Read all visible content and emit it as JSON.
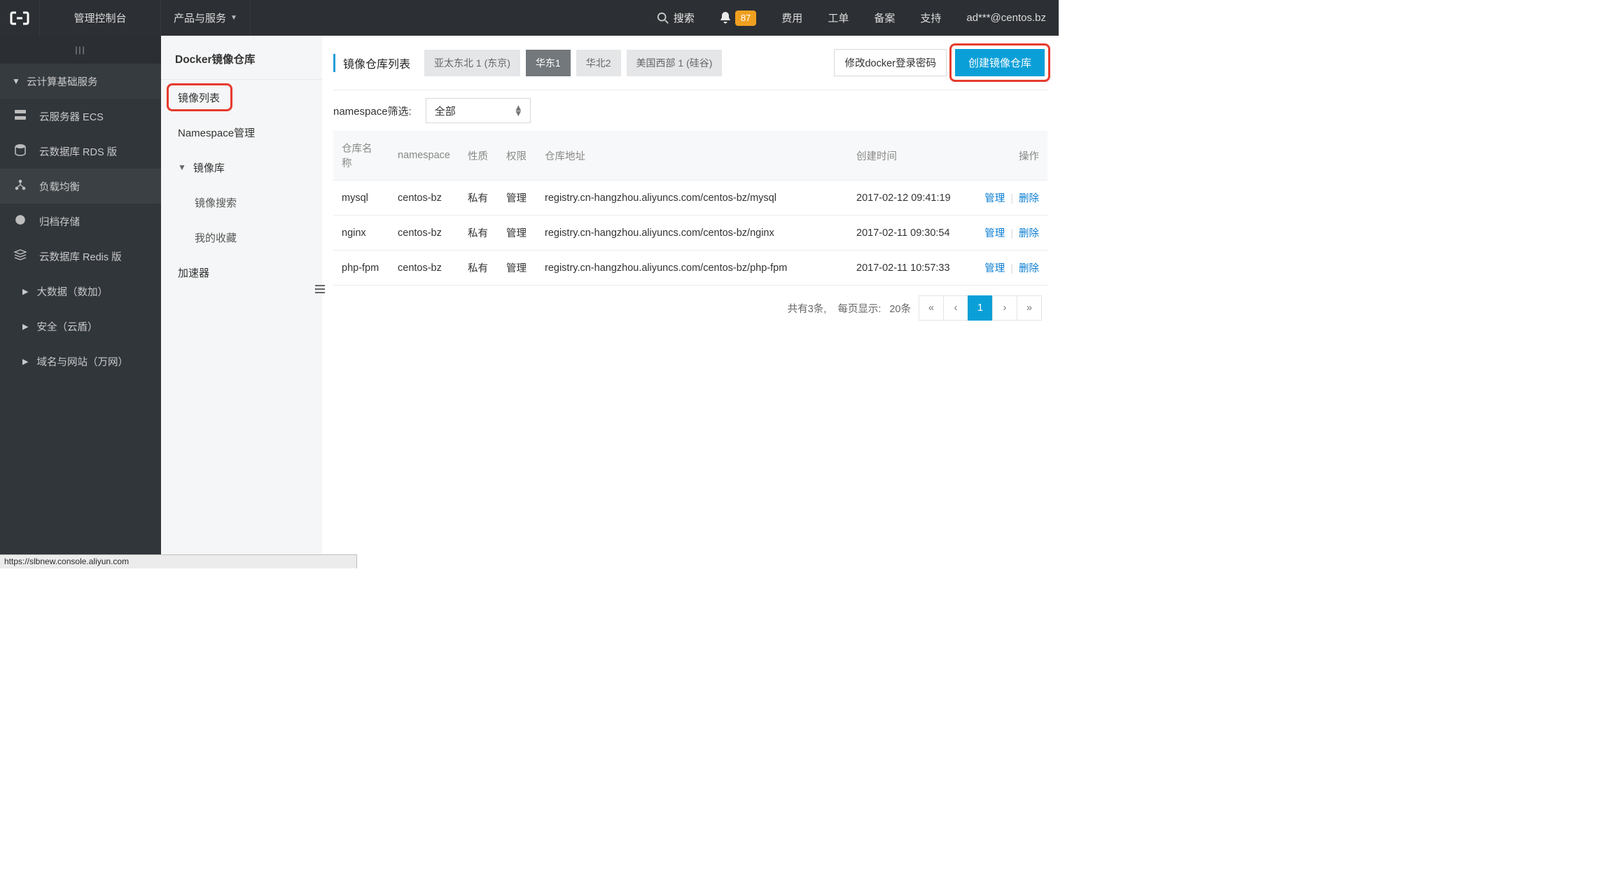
{
  "top": {
    "console": "管理控制台",
    "products": "产品与服务",
    "search": "搜索",
    "badge": "87",
    "links": [
      "费用",
      "工单",
      "备案",
      "支持"
    ],
    "account": "ad***@centos.bz"
  },
  "side_dark": {
    "group_head": "云计算基础服务",
    "items": [
      {
        "name": "ecs",
        "label": "云服务器 ECS"
      },
      {
        "name": "rds",
        "label": "云数据库 RDS 版"
      },
      {
        "name": "slb",
        "label": "负载均衡",
        "active": true
      },
      {
        "name": "oss",
        "label": "归档存储"
      },
      {
        "name": "redis",
        "label": "云数据库 Redis 版"
      }
    ],
    "group2": [
      "大数据（数加）",
      "安全（云盾）",
      "域名与网站（万网）"
    ]
  },
  "side_light": {
    "title": "Docker镜像仓库",
    "items": {
      "image_list": "镜像列表",
      "namespace": "Namespace管理",
      "image_lib": "镜像库",
      "image_search": "镜像搜索",
      "favorites": "我的收藏",
      "accelerator": "加速器"
    }
  },
  "main": {
    "crumb": "镜像仓库列表",
    "regions": [
      {
        "label": "亚太东北 1 (东京)",
        "active": false
      },
      {
        "label": "华东1",
        "active": true
      },
      {
        "label": "华北2",
        "active": false
      },
      {
        "label": "美国西部 1 (硅谷)",
        "active": false
      }
    ],
    "btn_pw": "修改docker登录密码",
    "btn_create": "创建镜像仓库",
    "filter_label": "namespace筛选:",
    "filter_value": "全部",
    "columns": {
      "name": "仓库名称",
      "ns": "namespace",
      "kind": "性质",
      "perm": "权限",
      "addr": "仓库地址",
      "time": "创建时间",
      "ops": "操作"
    },
    "rows": [
      {
        "name": "mysql",
        "ns": "centos-bz",
        "kind": "私有",
        "perm": "管理",
        "addr": "registry.cn-hangzhou.aliyuncs.com/centos-bz/mysql",
        "time": "2017-02-12 09:41:19"
      },
      {
        "name": "nginx",
        "ns": "centos-bz",
        "kind": "私有",
        "perm": "管理",
        "addr": "registry.cn-hangzhou.aliyuncs.com/centos-bz/nginx",
        "time": "2017-02-11 09:30:54"
      },
      {
        "name": "php-fpm",
        "ns": "centos-bz",
        "kind": "私有",
        "perm": "管理",
        "addr": "registry.cn-hangzhou.aliyuncs.com/centos-bz/php-fpm",
        "time": "2017-02-11 10:57:33"
      }
    ],
    "row_actions": {
      "manage": "管理",
      "delete": "删除"
    },
    "pager": {
      "total_label": "共有3条,",
      "per_label": "每页显示:",
      "per_value": "20条",
      "current": "1"
    }
  },
  "status_url": "https://slbnew.console.aliyun.com"
}
